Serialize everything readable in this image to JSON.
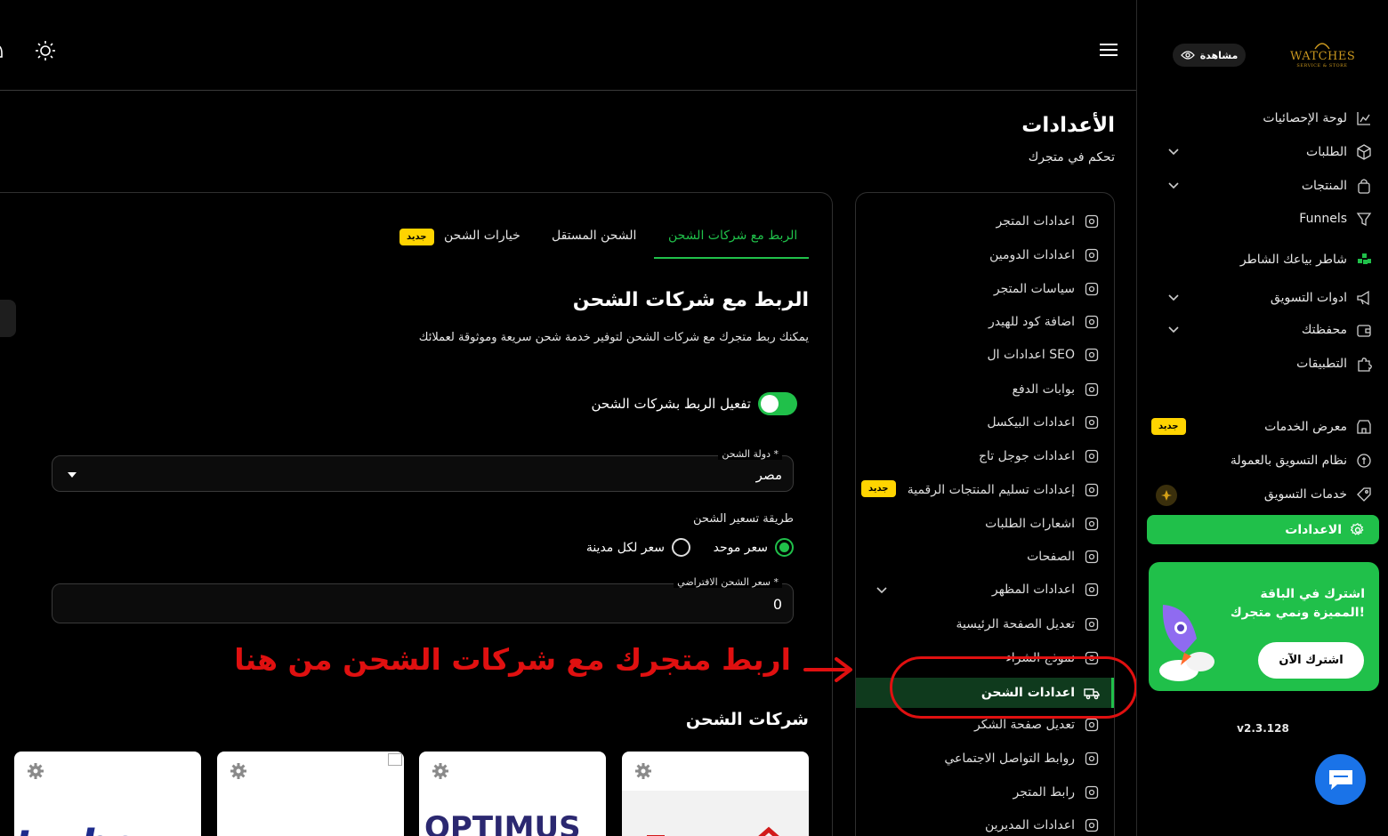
{
  "sidebar": {
    "logo": {
      "name": "WATCHES",
      "tagline": "SERVICE & STORE"
    },
    "view_button": "مشاهدة",
    "items": [
      {
        "label": "لوحة الإحصائيات",
        "icon": "chart-icon"
      },
      {
        "label": "الطلبات",
        "icon": "box-icon"
      },
      {
        "label": "المنتجات",
        "icon": "bag-icon"
      },
      {
        "label": "Funnels",
        "icon": "funnel-icon"
      },
      {
        "label": "شاطر بياعك الشاطر",
        "icon": "grid-icon"
      },
      {
        "label": "ادوات التسويق",
        "icon": "megaphone-icon"
      },
      {
        "label": "محفظتك",
        "icon": "wallet-icon"
      },
      {
        "label": "التطبيقات",
        "icon": "puzzle-icon"
      },
      {
        "label": "معرض الخدمات",
        "icon": "store-icon",
        "badge": "جديد"
      },
      {
        "label": "نظام التسويق بالعمولة",
        "icon": "coin-icon"
      },
      {
        "label": "خدمات التسويق",
        "icon": "tag-icon"
      }
    ],
    "active_item": "الاعدادات",
    "promo": {
      "title": "اشترك في الباقة المميزة ونمي متجرك!",
      "cta": "اشترك الآن"
    },
    "version": "v2.3.128"
  },
  "page": {
    "title": "الأعدادات",
    "subtitle": "تحكم في متجرك"
  },
  "settings_menu": {
    "items": [
      "اعدادات المتجر",
      "اعدادات الدومين",
      "سياسات المتجر",
      "اضافة كود للهيدر",
      "اعدادات ال SEO",
      "بوابات الدفع",
      "اعدادات البيكسل",
      "اعدادات جوجل تاج",
      "إعدادات تسليم المنتجات الرقمية",
      "اشعارات الطلبات",
      "الصفحات",
      "اعدادات المظهر",
      "تعديل الصفحة الرئيسية",
      "نموذج الشراء",
      "تعديل صفحة الشكر",
      "روابط التواصل الاجتماعي",
      "رابط المتجر",
      "اعدادات المديرين"
    ],
    "new_badge": "جديد",
    "active_item": "اعدادات الشحن"
  },
  "content": {
    "tabs": [
      {
        "label": "الربط مع شركات الشحن",
        "active": true
      },
      {
        "label": "الشحن المستقل",
        "active": false
      },
      {
        "label": "خيارات الشحن",
        "active": false,
        "badge": "جديد"
      }
    ],
    "section_title": "الربط مع شركات الشحن",
    "section_desc": "يمكنك ربط متجرك مع شركات الشحن لتوفير خدمة شحن سريعة وموثوقة لعملائك",
    "toggle_label": "تفعيل الربط بشركات الشحن",
    "toggle_on": true,
    "country_field": {
      "label": "دولة الشحن *",
      "value": "مصر"
    },
    "pricing_label": "طريقة تسعير الشحن",
    "pricing_options": [
      {
        "label": "سعر موحد",
        "selected": true
      },
      {
        "label": "سعر لكل مدينة",
        "selected": false
      }
    ],
    "default_price_field": {
      "label": "سعر الشحن الافتراضي *",
      "value": "0"
    },
    "annotation": "اربط متجرك مع شركات الشحن من هنا",
    "companies_title": "شركات الشحن",
    "companies": [
      "turbo",
      "",
      "OPTIMUS",
      ""
    ]
  },
  "colors": {
    "accent": "#20c04a",
    "annotation": "#e01010",
    "badge": "#ffd400"
  }
}
